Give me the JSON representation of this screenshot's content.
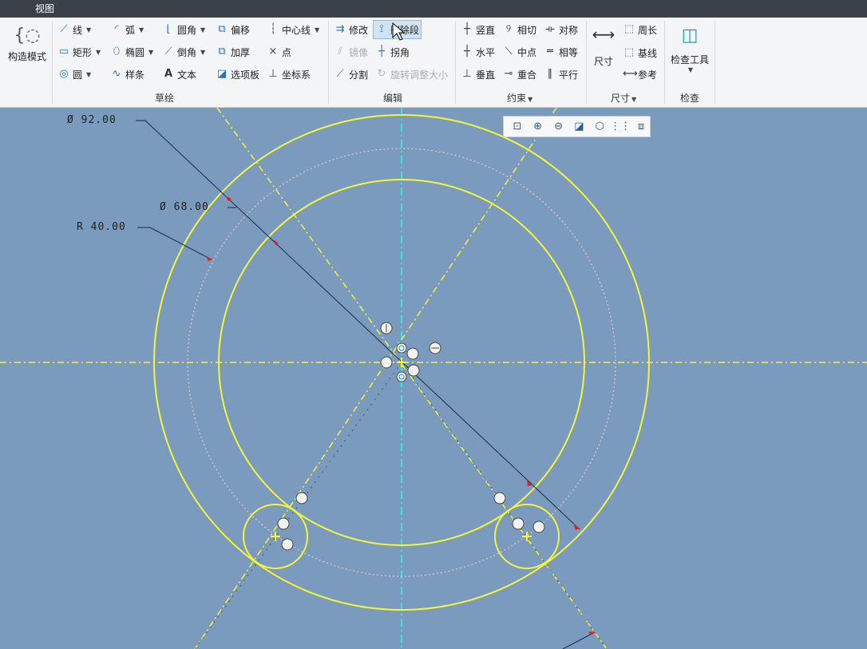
{
  "topbar": {
    "tab_view": "视图"
  },
  "ribbon": {
    "construction_mode": "构造模式",
    "sketch": {
      "line": "线",
      "arc": "弧",
      "fillet": "圆角",
      "offset": "偏移",
      "centerline": "中心线",
      "rectangle": "矩形",
      "ellipse": "椭圆",
      "chamfer": "倒角",
      "thicken": "加厚",
      "point": "点",
      "circle": "圆",
      "spline": "样条",
      "text": "文本",
      "palette": "选项板",
      "coordinate_system": "坐标系",
      "group_title": "草绘"
    },
    "edit": {
      "modify": "修改",
      "delete_segment": "删除段",
      "mirror": "镜像",
      "corner": "拐角",
      "divide": "分割",
      "rotate_resize": "旋转调整大小",
      "group_title": "编辑"
    },
    "constrain": {
      "vertical": "竖直",
      "tangent": "相切",
      "symmetric": "对称",
      "horizontal": "水平",
      "midpoint": "中点",
      "equal": "相等",
      "perpendicular": "垂直",
      "coincident": "重合",
      "parallel": "平行",
      "group_title": "约束"
    },
    "dimension": {
      "dimension": "尺寸",
      "perimeter": "周长",
      "baseline": "基线",
      "reference": "参考",
      "group_title": "尺寸"
    },
    "inspect": {
      "inspect_tools": "检查工具",
      "group_title": "检查"
    }
  },
  "dimensions": {
    "d1": "Ø 92.00",
    "d2": "Ø 68.00",
    "r1": "R 40.00"
  },
  "colors": {
    "sketch": "#f5f53a",
    "centerline_axis": "#40e0e0",
    "dimension": "#1a2a44",
    "canvas": "#7a9bbd"
  }
}
